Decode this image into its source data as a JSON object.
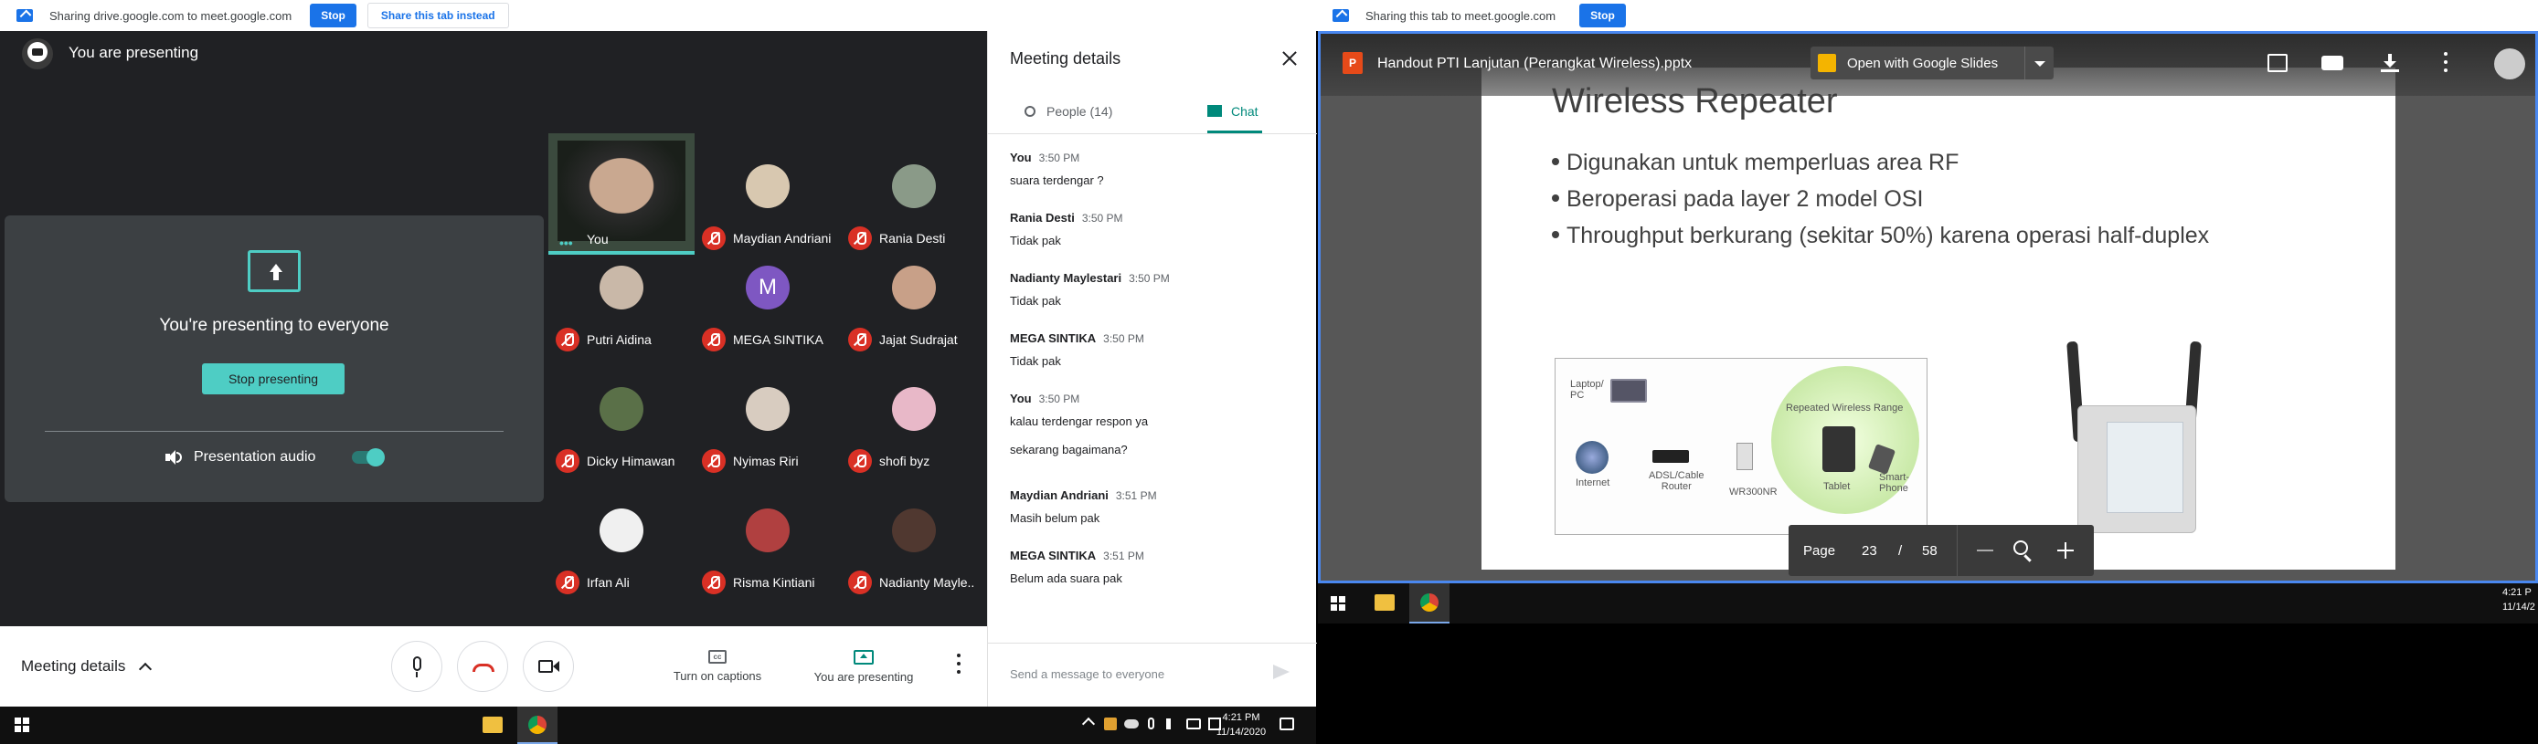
{
  "left_share_bar": {
    "text": "Sharing drive.google.com to meet.google.com",
    "stop": "Stop",
    "share_tab": "Share this tab instead"
  },
  "right_share_bar": {
    "text": "Sharing this tab to meet.google.com",
    "stop": "Stop"
  },
  "meet": {
    "header": "You are presenting",
    "presenting_card": {
      "title": "You're presenting to everyone",
      "stop_button": "Stop presenting",
      "audio_label": "Presentation audio"
    },
    "participants": [
      {
        "name": "You",
        "avatar_color": "#4a5a48"
      },
      {
        "name": "Maydian Andriani",
        "avatar_color": "#d8c8b0"
      },
      {
        "name": "Rania Desti",
        "avatar_color": "#8a9a88"
      },
      {
        "name": "Putri Aidina",
        "avatar_color": "#c9b8a8"
      },
      {
        "name": "MEGA SINTIKA",
        "avatar_color": "#7e57c2",
        "initial": "M"
      },
      {
        "name": "Jajat Sudrajat",
        "avatar_color": "#c8a088"
      },
      {
        "name": "Dicky Himawan",
        "avatar_color": "#5a7048"
      },
      {
        "name": "Nyimas Riri",
        "avatar_color": "#d8ccc0"
      },
      {
        "name": "shofi byz",
        "avatar_color": "#e8b8c8"
      },
      {
        "name": "Irfan Ali",
        "avatar_color": "#f0f0f0"
      },
      {
        "name": "Risma Kintiani",
        "avatar_color": "#b04040"
      },
      {
        "name": "Nadianty Mayle..",
        "avatar_color": "#503830"
      }
    ],
    "bottom": {
      "meeting_details": "Meeting details",
      "captions": "Turn on captions",
      "presenting": "You are presenting"
    }
  },
  "panel": {
    "title": "Meeting details",
    "tab_people": "People (14)",
    "tab_chat": "Chat",
    "messages": [
      {
        "sender": "You",
        "time": "3:50 PM",
        "lines": [
          "suara terdengar ?"
        ]
      },
      {
        "sender": "Rania Desti",
        "time": "3:50 PM",
        "lines": [
          "Tidak pak"
        ]
      },
      {
        "sender": "Nadianty Maylestari",
        "time": "3:50 PM",
        "lines": [
          "Tidak pak"
        ]
      },
      {
        "sender": "MEGA SINTIKA",
        "time": "3:50 PM",
        "lines": [
          "Tidak pak"
        ]
      },
      {
        "sender": "You",
        "time": "3:50 PM",
        "lines": [
          "kalau terdengar respon ya",
          "sekarang bagaimana?"
        ]
      },
      {
        "sender": "Maydian Andriani",
        "time": "3:51 PM",
        "lines": [
          "Masih belum pak"
        ]
      },
      {
        "sender": "MEGA SINTIKA",
        "time": "3:51 PM",
        "lines": [
          "Belum ada suara pak"
        ]
      }
    ],
    "input_placeholder": "Send a message to everyone"
  },
  "viewer": {
    "file_name": "Handout PTI Lanjutan (Perangkat Wireless).pptx",
    "open_with": "Open with Google Slides",
    "slide": {
      "title": "Wireless Repeater",
      "bullets": [
        "Digunakan untuk memperluas area RF",
        "Beroperasi pada layer 2 model OSI",
        "Throughput berkurang (sekitar 50%) karena operasi half-duplex"
      ],
      "diagram_labels": {
        "laptop": "Laptop/\nPC",
        "internet": "Internet",
        "router": "ADSL/Cable\nRouter",
        "repeater": "WR300NR",
        "range": "Repeated Wireless Range",
        "tablet": "Tablet",
        "phone": "Smart-\nPhone"
      }
    },
    "page_label": "Page",
    "page_current": "23",
    "page_sep": "/",
    "page_total": "58"
  },
  "taskbar_left": {
    "time": "4:21 PM",
    "date": "11/14/2020"
  },
  "taskbar_right": {
    "time": "4:21 P",
    "date": "11/14/2"
  }
}
